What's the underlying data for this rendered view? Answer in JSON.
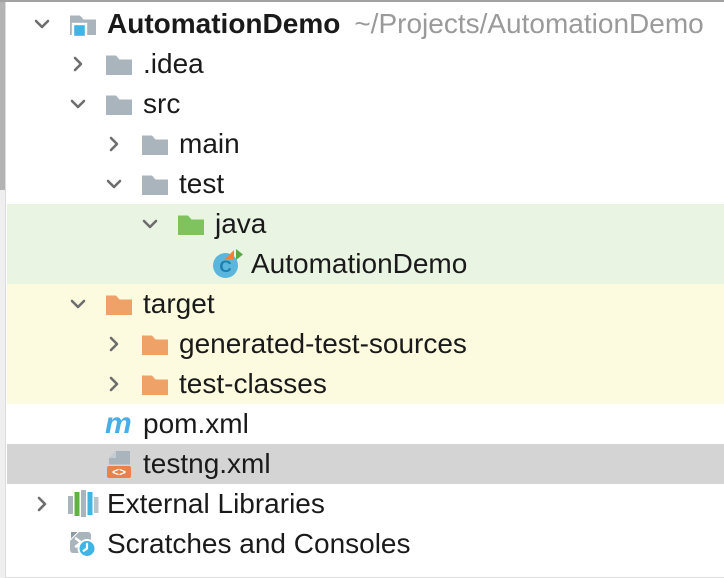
{
  "colors": {
    "row_green_bg": "#e9f4e3",
    "row_yellow_bg": "#fcfbdf",
    "row_selected_bg": "#d4d4d4",
    "folder_gray": "#a9b4bd",
    "folder_green": "#7fc35f",
    "folder_orange": "#efa267",
    "accent_blue": "#40b4e4",
    "maven_blue": "#49aee6",
    "xml_orange": "#e8824a",
    "lib_green": "#5fb441",
    "class_circle_blue": "#5ab6dc",
    "class_letter_blue": "#1d7fae",
    "run_marker_orange": "#ef8232",
    "run_marker_green": "#59a843",
    "chevron_gray": "#6d6d6d",
    "text_primary": "#1a1a1a",
    "text_path": "#9a9a9a"
  },
  "tree": {
    "items": [
      {
        "label": "AutomationDemo",
        "suffix": "~/Projects/AutomationDemo",
        "level": 0,
        "expand": "expanded",
        "icon": "project-folder",
        "row_bg": "none",
        "bold": true
      },
      {
        "label": ".idea",
        "level": 1,
        "expand": "collapsed",
        "icon": "folder",
        "row_bg": "none"
      },
      {
        "label": "src",
        "level": 1,
        "expand": "expanded",
        "icon": "folder",
        "row_bg": "none"
      },
      {
        "label": "main",
        "level": 2,
        "expand": "collapsed",
        "icon": "folder",
        "row_bg": "none"
      },
      {
        "label": "test",
        "level": 2,
        "expand": "expanded",
        "icon": "folder",
        "row_bg": "none"
      },
      {
        "label": "java",
        "level": 3,
        "expand": "expanded",
        "icon": "folder-green",
        "row_bg": "green"
      },
      {
        "label": "AutomationDemo",
        "level": 4,
        "expand": "none",
        "icon": "class",
        "row_bg": "green"
      },
      {
        "label": "target",
        "level": 1,
        "expand": "expanded",
        "icon": "folder-orange",
        "row_bg": "yellow"
      },
      {
        "label": "generated-test-sources",
        "level": 2,
        "expand": "collapsed",
        "icon": "folder-orange",
        "row_bg": "yellow"
      },
      {
        "label": "test-classes",
        "level": 2,
        "expand": "collapsed",
        "icon": "folder-orange",
        "row_bg": "yellow"
      },
      {
        "label": "pom.xml",
        "level": 1,
        "expand": "none",
        "icon": "maven",
        "row_bg": "none"
      },
      {
        "label": "testng.xml",
        "level": 1,
        "expand": "none",
        "icon": "xml",
        "row_bg": "selected",
        "selected": true
      },
      {
        "label": "External Libraries",
        "level": 0,
        "expand": "collapsed",
        "icon": "libraries",
        "row_bg": "none"
      },
      {
        "label": "Scratches and Consoles",
        "level": 0,
        "expand": "none",
        "icon": "scratches",
        "row_bg": "none"
      }
    ]
  }
}
